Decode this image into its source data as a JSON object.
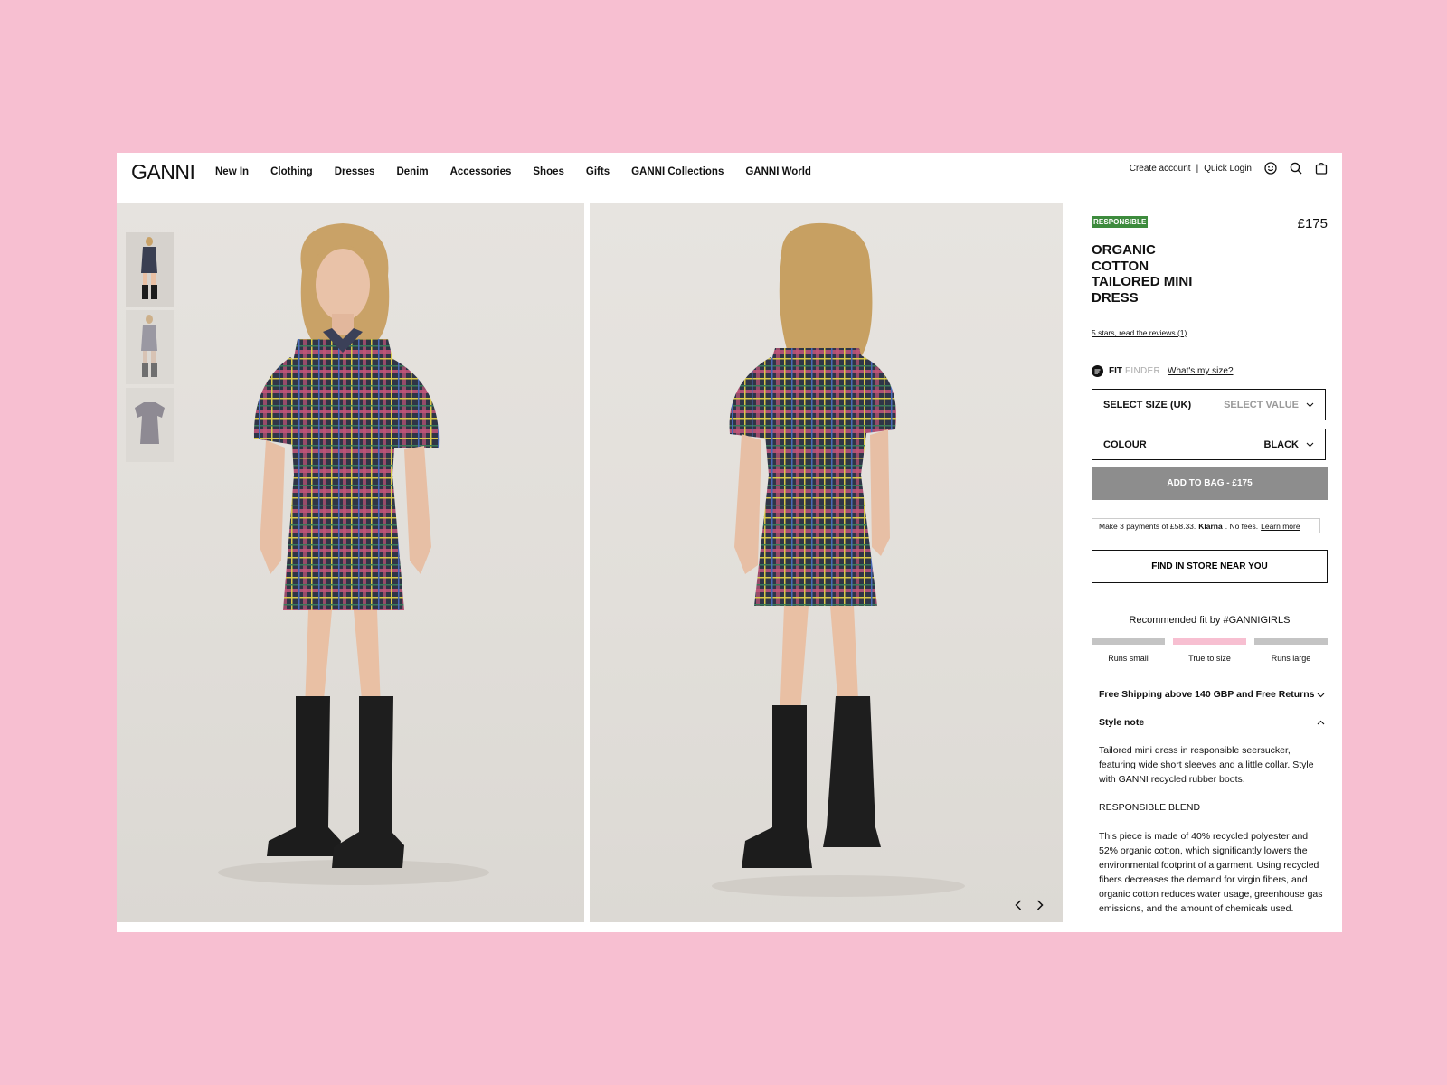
{
  "brand": "GANNI",
  "nav": [
    "New In",
    "Clothing",
    "Dresses",
    "Denim",
    "Accessories",
    "Shoes",
    "Gifts",
    "GANNI Collections",
    "GANNI World"
  ],
  "account": {
    "create": "Create account",
    "separator": "|",
    "login": "Quick Login"
  },
  "icons": [
    "smiley-icon",
    "search-icon",
    "bag-icon",
    "chevron-left-icon",
    "chevron-right-icon"
  ],
  "product": {
    "badge": "RESPONSIBLE",
    "price": "£175",
    "title": "ORGANIC COTTON TAILORED MINI DRESS",
    "reviews": "5 stars, read the reviews (1)"
  },
  "fit_finder": {
    "fit": "FIT",
    "finder": "FINDER",
    "question": "What's my size?"
  },
  "size_select": {
    "label": "SELECT SIZE (UK)",
    "value": "SELECT VALUE"
  },
  "colour_select": {
    "label": "COLOUR",
    "value": "BLACK"
  },
  "add_to_bag": "ADD TO BAG - £175",
  "klarna": {
    "prefix": "Make 3 payments of £58.33.",
    "brand": "Klarna",
    "suffix": ". No fees.",
    "link": "Learn more"
  },
  "find_in_store": "FIND IN STORE NEAR YOU",
  "recommended_fit": {
    "title": "Recommended fit by #GANNIGIRLS",
    "options": [
      "Runs small",
      "True to size",
      "Runs large"
    ],
    "selected": "True to size"
  },
  "shipping": "Free Shipping above 140 GBP and Free Returns",
  "style_note": {
    "heading": "Style note",
    "text": "Tailored mini dress in responsible seersucker, featuring wide short sleeves and a little collar. Style with GANNI recycled rubber boots.",
    "blend_heading": "RESPONSIBLE BLEND",
    "blend_text": "This piece is made of 40% recycled polyester and 52% organic cotton, which significantly lowers the environmental footprint of a garment. Using recycled fibers decreases the demand for virgin fibers, and organic cotton reduces water usage, greenhouse gas emissions, and the amount of chemicals used."
  },
  "colors": {
    "background": "#f7bfd1",
    "badge": "#3d8b3d",
    "button_disabled": "#8d8d8d",
    "fit_active": "#f7bfd1",
    "fit_inactive": "#c4c4c4"
  }
}
